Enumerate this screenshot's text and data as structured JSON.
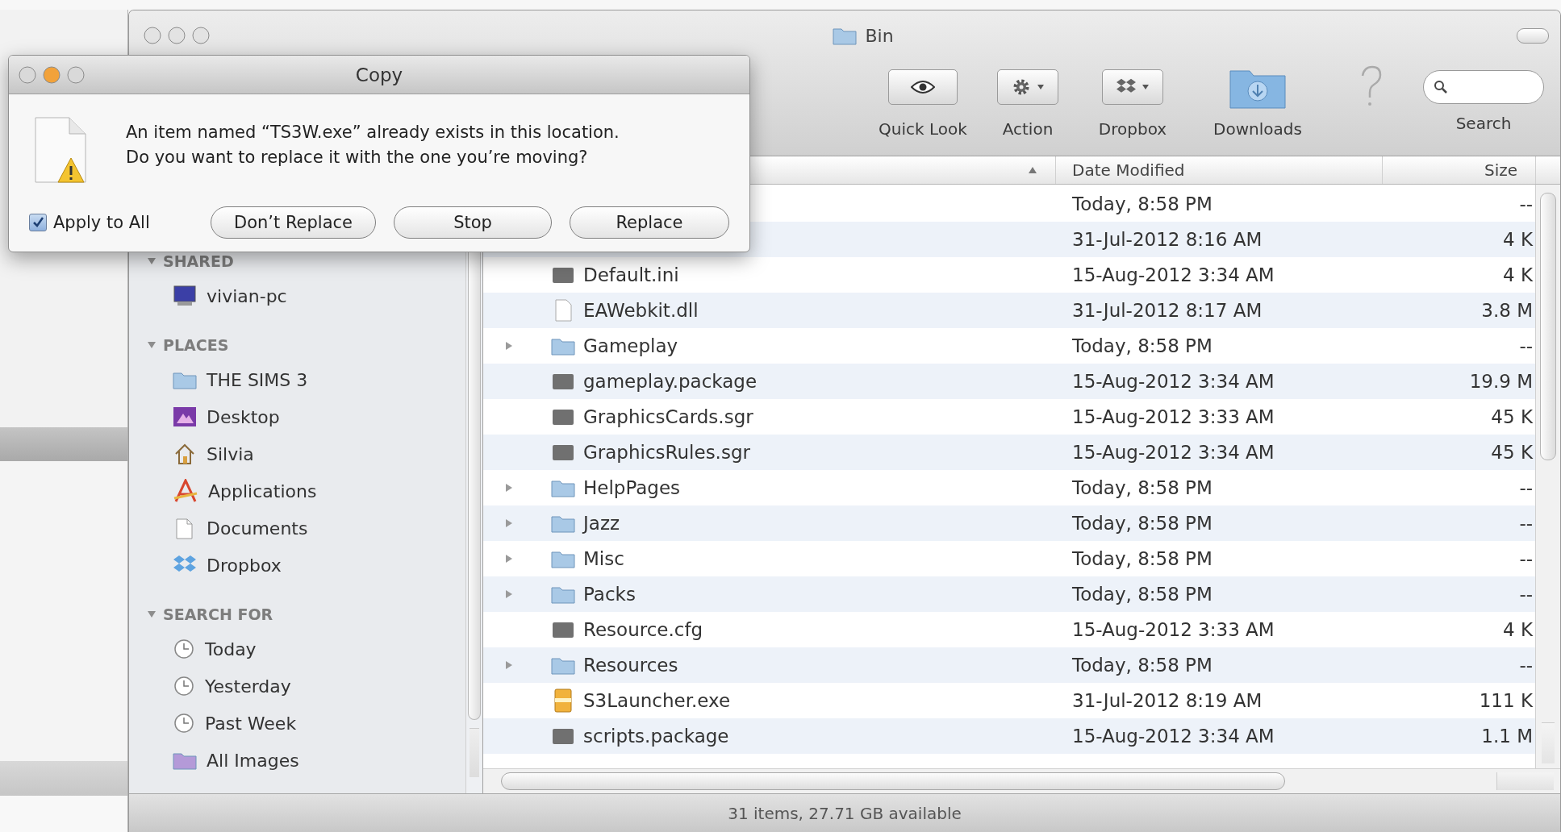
{
  "finder": {
    "title": "Bin",
    "toolbar": [
      {
        "kind": "quick-look",
        "label": "Quick Look"
      },
      {
        "kind": "action",
        "label": "Action"
      },
      {
        "kind": "dropbox",
        "label": "Dropbox"
      },
      {
        "kind": "downloads",
        "label": "Downloads"
      },
      {
        "kind": "help"
      },
      {
        "kind": "search",
        "label": "Search"
      }
    ],
    "sidebar": [
      {
        "heading": "SHARED",
        "expanded": true,
        "items": [
          {
            "kind": "computer",
            "label": "vivian-pc"
          }
        ]
      },
      {
        "heading": "PLACES",
        "expanded": true,
        "items": [
          {
            "kind": "folder",
            "label": "THE SIMS 3"
          },
          {
            "kind": "desktop",
            "label": "Desktop"
          },
          {
            "kind": "home",
            "label": "Silvia"
          },
          {
            "kind": "applications",
            "label": "Applications"
          },
          {
            "kind": "documents",
            "label": "Documents"
          },
          {
            "kind": "dropbox",
            "label": "Dropbox"
          }
        ]
      },
      {
        "heading": "SEARCH FOR",
        "expanded": true,
        "items": [
          {
            "kind": "clock",
            "label": "Today"
          },
          {
            "kind": "clock",
            "label": "Yesterday"
          },
          {
            "kind": "clock",
            "label": "Past Week"
          },
          {
            "kind": "images",
            "label": "All Images"
          }
        ]
      }
    ],
    "columns": [
      {
        "kind": "name",
        "sorted": true
      },
      {
        "kind": "date",
        "label": "Date Modified",
        "sorted": false
      },
      {
        "kind": "size",
        "label": "Size",
        "sorted": false
      }
    ],
    "rows": [
      {
        "date": "Today, 8:58 PM",
        "size": "--"
      },
      {
        "date": "31-Jul-2012 8:16 AM",
        "size": "4 K"
      },
      {
        "kind": "file",
        "name": "Default.ini",
        "date": "15-Aug-2012 3:34 AM",
        "size": "4 K"
      },
      {
        "kind": "document",
        "name": "EAWebkit.dll",
        "date": "31-Jul-2012 8:17 AM",
        "size": "3.8 M"
      },
      {
        "kind": "folder",
        "name": "Gameplay",
        "date": "Today, 8:58 PM",
        "size": "--"
      },
      {
        "kind": "file",
        "name": "gameplay.package",
        "date": "15-Aug-2012 3:34 AM",
        "size": "19.9 M"
      },
      {
        "kind": "file",
        "name": "GraphicsCards.sgr",
        "date": "15-Aug-2012 3:33 AM",
        "size": "45 K"
      },
      {
        "kind": "file",
        "name": "GraphicsRules.sgr",
        "date": "15-Aug-2012 3:34 AM",
        "size": "45 K"
      },
      {
        "kind": "folder",
        "name": "HelpPages",
        "date": "Today, 8:58 PM",
        "size": "--"
      },
      {
        "kind": "folder",
        "name": "Jazz",
        "date": "Today, 8:58 PM",
        "size": "--"
      },
      {
        "kind": "folder",
        "name": "Misc",
        "date": "Today, 8:58 PM",
        "size": "--"
      },
      {
        "kind": "folder",
        "name": "Packs",
        "date": "Today, 8:58 PM",
        "size": "--"
      },
      {
        "kind": "file",
        "name": "Resource.cfg",
        "date": "15-Aug-2012 3:33 AM",
        "size": "4 K"
      },
      {
        "kind": "folder",
        "name": "Resources",
        "date": "Today, 8:58 PM",
        "size": "--"
      },
      {
        "kind": "exe",
        "name": "S3Launcher.exe",
        "date": "31-Jul-2012 8:19 AM",
        "size": "111 K"
      },
      {
        "kind": "file",
        "name": "scripts.package",
        "date": "15-Aug-2012 3:34 AM",
        "size": "1.1 M"
      }
    ],
    "status": "31 items, 27.71 GB available"
  },
  "dialog": {
    "title": "Copy",
    "message": [
      "An item named “TS3W.exe” already exists in this location.",
      "Do you want to replace it with the one you’re moving?"
    ],
    "apply_to_all": {
      "label": "Apply to All",
      "checked": true
    },
    "buttons": [
      "Don’t Replace",
      "Stop",
      "Replace"
    ]
  }
}
